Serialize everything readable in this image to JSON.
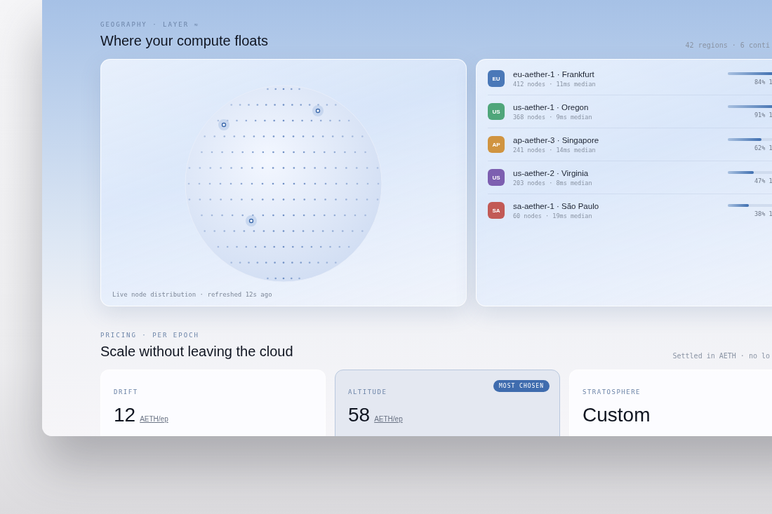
{
  "geography": {
    "eyebrow": "GEOGRAPHY · LAYER ≈",
    "title": "Where your compute floats",
    "meta": "42 regions · 6 conti",
    "map_caption": "Live node distribution · refreshed 12s ago",
    "regions": [
      {
        "code": "EU",
        "color": "#4a78b8",
        "name": "eu-aether-1 · Frankfurt",
        "detail": "412 nodes · 11ms median",
        "level": 0.84,
        "reading": "84% 1"
      },
      {
        "code": "US",
        "color": "#4fa67a",
        "name": "us-aether-1 · Oregon",
        "detail": "368 nodes · 9ms median",
        "level": 0.91,
        "reading": "91% 1"
      },
      {
        "code": "AP",
        "color": "#d09440",
        "name": "ap-aether-3 · Singapore",
        "detail": "241 nodes · 14ms median",
        "level": 0.62,
        "reading": "62% 1"
      },
      {
        "code": "US",
        "color": "#7d5fb0",
        "name": "us-aether-2 · Virginia",
        "detail": "203 nodes · 8ms median",
        "level": 0.47,
        "reading": "47% 1"
      },
      {
        "code": "SA",
        "color": "#c25a56",
        "name": "sa-aether-1 · São Paulo",
        "detail": "60 nodes · 19ms median",
        "level": 0.38,
        "reading": "38% 1"
      }
    ]
  },
  "pricing": {
    "eyebrow": "PRICING · PER EPOCH",
    "title": "Scale without leaving the cloud",
    "meta": "Settled in AETH · no lo",
    "tiers": [
      {
        "name": "DRIFT",
        "price": "12",
        "unit": "AETH/ep",
        "featured": false
      },
      {
        "name": "ALTITUDE",
        "price": "58",
        "unit": "AETH/ep",
        "featured": true,
        "badge": "MOST CHOSEN"
      },
      {
        "name": "STRATOSPHERE",
        "price": "Custom",
        "featured": false
      }
    ]
  }
}
